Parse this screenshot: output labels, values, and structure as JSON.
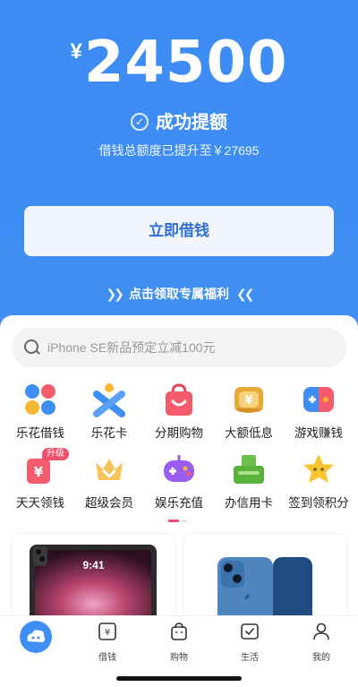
{
  "hero": {
    "currency": "¥",
    "amount": "24500",
    "success_text": "成功提额",
    "subline": "借钱总额度已提升至￥27695",
    "borrow_button": "立即借钱",
    "benefit_text": "点击领取专属福利"
  },
  "search": {
    "placeholder": "iPhone SE新品预定立减100元"
  },
  "grid": {
    "items": [
      {
        "label": "乐花借钱",
        "icon": "flower-icon"
      },
      {
        "label": "乐花卡",
        "icon": "card-x-icon"
      },
      {
        "label": "分期购物",
        "icon": "shopping-bag-icon"
      },
      {
        "label": "大额低息",
        "icon": "wallet-yen-icon"
      },
      {
        "label": "游戏赚钱",
        "icon": "game-controller-icon"
      },
      {
        "label": "天天领钱",
        "icon": "coupon-yen-icon"
      },
      {
        "label": "超级会员",
        "icon": "crown-icon"
      },
      {
        "label": "娱乐充值",
        "icon": "gamepad-purple-icon"
      },
      {
        "label": "办信用卡",
        "icon": "credit-card-green-icon"
      },
      {
        "label": "签到领积分",
        "icon": "star-icon"
      }
    ],
    "badge": "升级"
  },
  "products": {
    "ipad_time": "9:41"
  },
  "tabbar": {
    "items": [
      {
        "label": "",
        "icon": "home-cloud-icon"
      },
      {
        "label": "借钱",
        "icon": "loan-yen-icon"
      },
      {
        "label": "购物",
        "icon": "bag-icon"
      },
      {
        "label": "生活",
        "icon": "life-check-icon"
      },
      {
        "label": "我的",
        "icon": "person-icon"
      }
    ]
  },
  "colors": {
    "hero_blue": "#3f8ef4",
    "button_text": "#2e6fd4",
    "accent_pink": "#ef4d6f"
  }
}
